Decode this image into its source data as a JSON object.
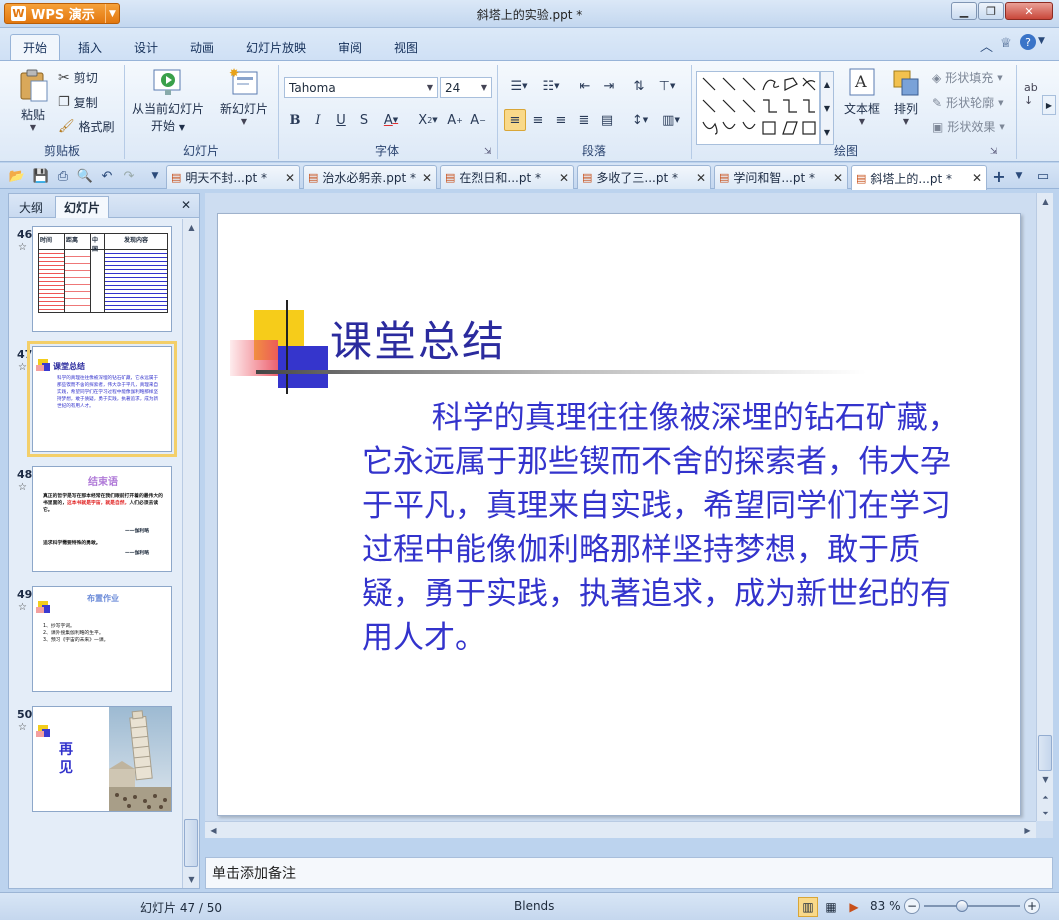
{
  "app": {
    "brand": "WPS 演示",
    "logo_letter": "W",
    "title": "斜塔上的实验.ppt *"
  },
  "menu": {
    "tabs": [
      "开始",
      "插入",
      "设计",
      "动画",
      "幻灯片放映",
      "审阅",
      "视图"
    ]
  },
  "ribbon": {
    "clipboard": {
      "paste": "粘贴",
      "cut": "剪切",
      "copy": "复制",
      "format_painter": "格式刷",
      "group": "剪贴板"
    },
    "slides": {
      "from_current": "从当前幻灯片",
      "from_current_2": "开始",
      "new_slide": "新幻灯片",
      "group": "幻灯片"
    },
    "font": {
      "name": "Tahoma",
      "size": "24",
      "group": "字体"
    },
    "paragraph": {
      "group": "段落"
    },
    "drawing": {
      "textbox": "文本框",
      "arrange": "排列",
      "shape_fill": "形状填充",
      "shape_outline": "形状轮廓",
      "shape_effect": "形状效果",
      "group": "绘图"
    }
  },
  "doc_tabs": [
    {
      "label": "明天不封...pt *"
    },
    {
      "label": "治水必躬亲.ppt *"
    },
    {
      "label": "在烈日和...pt *"
    },
    {
      "label": "多收了三...pt *"
    },
    {
      "label": "学问和智...pt *"
    },
    {
      "label": "斜塔上的...pt *"
    }
  ],
  "left_pane": {
    "tab_outline": "大纲",
    "tab_slides": "幻灯片",
    "thumbs": [
      {
        "num": "46",
        "star": "☆"
      },
      {
        "num": "47",
        "star": "☆",
        "title": "课堂总结",
        "body": "科学的真理往往像被深埋的钻石矿藏，它永远属于那些锲而不舍的探索者，伟大孕于平凡，真理来自实践，希望同学们在学习过程中能像伽利略那样坚持梦想，敢于质疑，勇于实践，执著追求，成为新世纪的有用人才。"
      },
      {
        "num": "48",
        "star": "☆",
        "title": "结束语",
        "line1": "真正的哲学是写在那本经常在我们眼前打开着的最伟大的书里面的，",
        "line2": "这本书就是宇宙，就是自然，",
        "line3": "人们必须去读它。",
        "sig": "——伽利略",
        "line4": "追求科学需要特殊的勇敢。",
        "sig2": "——伽利略"
      },
      {
        "num": "49",
        "star": "☆",
        "title": "布置作业",
        "items": [
          "1、抄写字词。",
          "2、课外搜集伽利略的生平。",
          "3、预习《宇宙的未来》一课。"
        ]
      },
      {
        "num": "50",
        "star": "☆",
        "title": "再见"
      }
    ],
    "thumb46": {
      "h1": "时间",
      "h2": "距离",
      "h3": "中国",
      "h4": "发现内容"
    }
  },
  "slide": {
    "title": "课堂总结",
    "body": "科学的真理往往像被深埋的钻石矿藏，它永远属于那些锲而不舍的探索者，伟大孕于平凡，真理来自实践，希望同学们在学习过程中能像伽利略那样坚持梦想，敢于质疑，勇于实践，执著追求，成为新世纪的有用人才。"
  },
  "notes": {
    "placeholder": "单击添加备注"
  },
  "status": {
    "slide_pos": "幻灯片 47 / 50",
    "theme": "Blends",
    "zoom": "83 %"
  },
  "colors": {
    "accent": "#e2770f",
    "slide_text": "#3333cc",
    "title_text": "#2b2b9e"
  }
}
